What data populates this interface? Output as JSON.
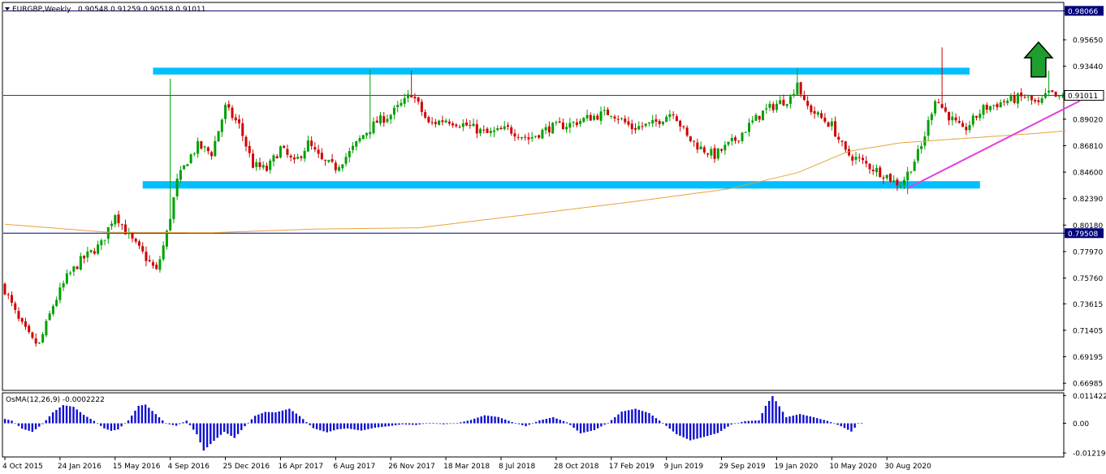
{
  "header": {
    "symbol_label": "EURGBP,Weekly",
    "ohlc_text": "0.90548 0.91259 0.90518 0.91011"
  },
  "osma_header": {
    "label": "OsMA(12,26,9) -0.0002222"
  },
  "colors": {
    "bull": "#00a000",
    "bear": "#d00000",
    "zone": "#00bfff",
    "ma": "#e8a33a",
    "trendline": "#e040e0",
    "arrow_fill": "#1e9e2e",
    "osma": "#1010d0",
    "hline": "#00007a",
    "current_line": "#000000"
  },
  "chart_data": {
    "type": "candlestick",
    "symbol": "EURGBP",
    "timeframe": "Weekly",
    "ylim": [
      0.6645,
      0.987
    ],
    "y_ticks": [
      {
        "value": 0.98066,
        "label": "0.98066",
        "highlight": true
      },
      {
        "value": 0.9565,
        "label": "0.95650"
      },
      {
        "value": 0.9344,
        "label": "0.93440"
      },
      {
        "value": 0.91011,
        "label": "0.91011",
        "highlight": "current"
      },
      {
        "value": 0.8902,
        "label": "0.89020"
      },
      {
        "value": 0.8681,
        "label": "0.86810"
      },
      {
        "value": 0.846,
        "label": "0.84600"
      },
      {
        "value": 0.8239,
        "label": "0.82390"
      },
      {
        "value": 0.8018,
        "label": "0.80180"
      },
      {
        "value": 0.79508,
        "label": "0.79508",
        "highlight": true
      },
      {
        "value": 0.7797,
        "label": "0.77970"
      },
      {
        "value": 0.7576,
        "label": "0.75760"
      },
      {
        "value": 0.7361,
        "label": "0.73615"
      },
      {
        "value": 0.714,
        "label": "0.71405"
      },
      {
        "value": 0.6919,
        "label": "0.69195"
      },
      {
        "value": 0.6698,
        "label": "0.66985"
      }
    ],
    "x_labels": [
      "4 Oct 2015",
      "24 Jan 2016",
      "15 May 2016",
      "4 Sep 2016",
      "25 Dec 2016",
      "16 Apr 2017",
      "6 Aug 2017",
      "26 Nov 2017",
      "18 Mar 2018",
      "8 Jul 2018",
      "28 Oct 2018",
      "17 Feb 2019",
      "9 Jun 2019",
      "29 Sep 2019",
      "19 Jan 2020",
      "10 May 2020",
      "30 Aug 2020"
    ],
    "bar_count": 262,
    "x_label_bar_step": 16,
    "close_path_anchors": [
      [
        0,
        0.748
      ],
      [
        4,
        0.722
      ],
      [
        8,
        0.705
      ],
      [
        10,
        0.702
      ],
      [
        14,
        0.735
      ],
      [
        18,
        0.758
      ],
      [
        22,
        0.772
      ],
      [
        28,
        0.786
      ],
      [
        32,
        0.812
      ],
      [
        36,
        0.792
      ],
      [
        40,
        0.778
      ],
      [
        44,
        0.763
      ],
      [
        47,
        0.795
      ],
      [
        50,
        0.838
      ],
      [
        53,
        0.856
      ],
      [
        56,
        0.868
      ],
      [
        60,
        0.862
      ],
      [
        64,
        0.9
      ],
      [
        68,
        0.885
      ],
      [
        72,
        0.852
      ],
      [
        76,
        0.848
      ],
      [
        80,
        0.866
      ],
      [
        84,
        0.853
      ],
      [
        88,
        0.87
      ],
      [
        92,
        0.855
      ],
      [
        96,
        0.85
      ],
      [
        100,
        0.862
      ],
      [
        104,
        0.877
      ],
      [
        108,
        0.888
      ],
      [
        112,
        0.894
      ],
      [
        116,
        0.905
      ],
      [
        118,
        0.912
      ],
      [
        120,
        0.902
      ],
      [
        123,
        0.886
      ],
      [
        128,
        0.89
      ],
      [
        134,
        0.885
      ],
      [
        140,
        0.878
      ],
      [
        146,
        0.882
      ],
      [
        152,
        0.874
      ],
      [
        158,
        0.883
      ],
      [
        164,
        0.886
      ],
      [
        170,
        0.892
      ],
      [
        176,
        0.896
      ],
      [
        182,
        0.883
      ],
      [
        188,
        0.886
      ],
      [
        194,
        0.897
      ],
      [
        198,
        0.875
      ],
      [
        202,
        0.866
      ],
      [
        206,
        0.86
      ],
      [
        212,
        0.873
      ],
      [
        216,
        0.885
      ],
      [
        220,
        0.896
      ],
      [
        224,
        0.903
      ],
      [
        228,
        0.908
      ],
      [
        230,
        0.922
      ],
      [
        232,
        0.903
      ],
      [
        236,
        0.893
      ],
      [
        240,
        0.885
      ],
      [
        244,
        0.862
      ],
      [
        248,
        0.856
      ],
      [
        252,
        0.849
      ],
      [
        256,
        0.843
      ],
      [
        258,
        0.838
      ],
      [
        260,
        0.836
      ],
      [
        262,
        0.845
      ],
      [
        266,
        0.867
      ],
      [
        270,
        0.908
      ],
      [
        273,
        0.896
      ],
      [
        278,
        0.88
      ],
      [
        284,
        0.899
      ],
      [
        290,
        0.905
      ],
      [
        296,
        0.909
      ],
      [
        300,
        0.902
      ],
      [
        303,
        0.912
      ],
      [
        306,
        0.907
      ],
      [
        308,
        0.91
      ]
    ],
    "spikes": [
      {
        "bar": 48,
        "high": 0.924
      },
      {
        "bar": 106,
        "high": 0.9313
      },
      {
        "bar": 118,
        "high": 0.9307
      },
      {
        "bar": 230,
        "high": 0.9326
      },
      {
        "bar": 272,
        "high": 0.9502
      },
      {
        "bar": 303,
        "high": 0.9307
      },
      {
        "bar": 262,
        "low": 0.8276
      }
    ],
    "moving_average": {
      "period": 200,
      "points": [
        [
          0,
          0.8025
        ],
        [
          30,
          0.7958
        ],
        [
          60,
          0.7955
        ],
        [
          90,
          0.7985
        ],
        [
          120,
          0.7995
        ],
        [
          150,
          0.81
        ],
        [
          180,
          0.8205
        ],
        [
          210,
          0.832
        ],
        [
          230,
          0.8455
        ],
        [
          245,
          0.8635
        ],
        [
          260,
          0.8705
        ],
        [
          280,
          0.8745
        ],
        [
          300,
          0.8785
        ],
        [
          308,
          0.8805
        ]
      ]
    },
    "zones": [
      {
        "from_bar": 43,
        "to_bar": 280,
        "low": 0.9275,
        "high": 0.9332
      },
      {
        "from_bar": 40,
        "to_bar": 283,
        "low": 0.8323,
        "high": 0.8385
      }
    ],
    "horizontal_lines": [
      0.98066,
      0.79508
    ],
    "current_price": 0.91011,
    "trendline": {
      "from_bar": 262,
      "from_price": 0.8325,
      "to_bar": 312,
      "to_price": 0.9055
    },
    "arrow": {
      "bar": 300,
      "low": 0.9255,
      "high": 0.9545,
      "direction": "up"
    },
    "osma": {
      "label": "OsMA(12,26,9) -0.0002222",
      "ylim": [
        -0.0135,
        0.0122
      ],
      "y_ticks": [
        {
          "value": 0.011422,
          "label": "0.011422"
        },
        {
          "value": 0.0,
          "label": "0.00"
        },
        {
          "value": -0.012191,
          "label": "-0.012191"
        }
      ],
      "anchors": [
        [
          0,
          0.0018
        ],
        [
          2,
          0.0011
        ],
        [
          5,
          -0.0022
        ],
        [
          8,
          -0.0035
        ],
        [
          11,
          -0.0003
        ],
        [
          14,
          0.0045
        ],
        [
          17,
          0.0075
        ],
        [
          20,
          0.0068
        ],
        [
          23,
          0.0035
        ],
        [
          26,
          0.001
        ],
        [
          29,
          -0.0021
        ],
        [
          31,
          -0.0031
        ],
        [
          33,
          -0.0025
        ],
        [
          36,
          0.0012
        ],
        [
          39,
          0.0072
        ],
        [
          41,
          0.0077
        ],
        [
          44,
          0.0038
        ],
        [
          47,
          -0.0001
        ],
        [
          50,
          -0.001
        ],
        [
          53,
          0.0011
        ],
        [
          56,
          -0.0045
        ],
        [
          58,
          -0.0112
        ],
        [
          61,
          -0.0072
        ],
        [
          64,
          -0.0035
        ],
        [
          67,
          -0.006
        ],
        [
          70,
          -0.0012
        ],
        [
          73,
          0.0031
        ],
        [
          76,
          0.0047
        ],
        [
          79,
          0.0045
        ],
        [
          83,
          0.006
        ],
        [
          86,
          0.003
        ],
        [
          90,
          -0.002
        ],
        [
          94,
          -0.0037
        ],
        [
          97,
          -0.0025
        ],
        [
          100,
          -0.0021
        ],
        [
          104,
          -0.003
        ],
        [
          108,
          -0.0018
        ],
        [
          112,
          -0.0012
        ],
        [
          116,
          -0.0004
        ],
        [
          120,
          -0.0007
        ],
        [
          124,
          0.0002
        ],
        [
          128,
          -0.0004
        ],
        [
          132,
          0.0001
        ],
        [
          136,
          0.0014
        ],
        [
          140,
          0.0033
        ],
        [
          144,
          0.0026
        ],
        [
          148,
          0.0005
        ],
        [
          152,
          -0.0012
        ],
        [
          156,
          0.0012
        ],
        [
          160,
          0.0025
        ],
        [
          164,
          0.0004
        ],
        [
          168,
          -0.0041
        ],
        [
          172,
          -0.0028
        ],
        [
          176,
          0.0002
        ],
        [
          180,
          0.0048
        ],
        [
          184,
          0.006
        ],
        [
          188,
          0.0042
        ],
        [
          192,
          0.0001
        ],
        [
          196,
          -0.0045
        ],
        [
          200,
          -0.007
        ],
        [
          204,
          -0.0056
        ],
        [
          208,
          -0.004
        ],
        [
          212,
          -0.0005
        ],
        [
          216,
          0.0009
        ],
        [
          220,
          0.0012
        ],
        [
          222,
          0.0072
        ],
        [
          224,
          0.0112
        ],
        [
          226,
          0.007
        ],
        [
          228,
          0.0025
        ],
        [
          232,
          0.0038
        ],
        [
          236,
          0.0025
        ],
        [
          240,
          0.001
        ],
        [
          244,
          -0.0012
        ],
        [
          247,
          -0.0034
        ],
        [
          249,
          -0.0002
        ],
        [
          250,
          0.0001
        ]
      ]
    }
  }
}
